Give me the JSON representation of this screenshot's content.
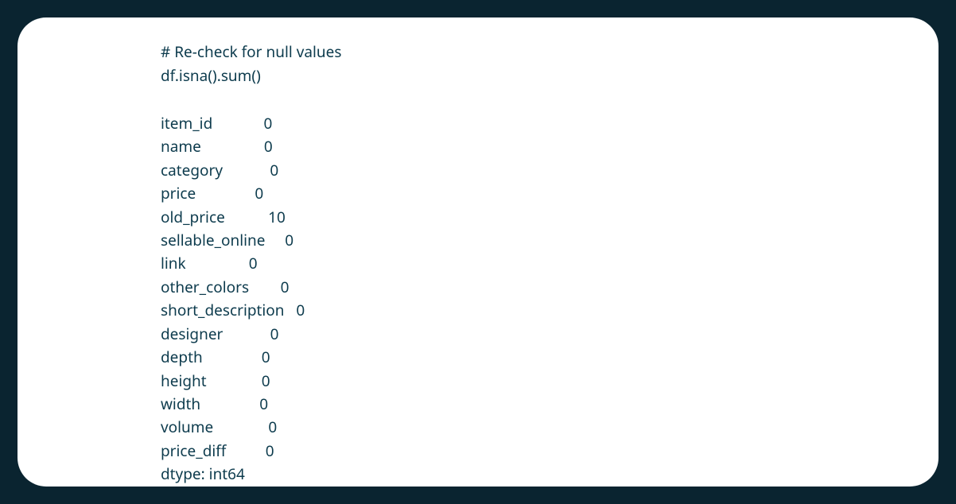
{
  "code": {
    "comment": "# Re-check for null values",
    "statement": "df.isna().sum()"
  },
  "output": {
    "rows": [
      {
        "label": "item_id",
        "value": "0"
      },
      {
        "label": "name",
        "value": "0"
      },
      {
        "label": "category",
        "value": "0"
      },
      {
        "label": "price",
        "value": "0"
      },
      {
        "label": "old_price",
        "value": "10"
      },
      {
        "label": "sellable_online",
        "value": "0"
      },
      {
        "label": "link",
        "value": "0"
      },
      {
        "label": "other_colors",
        "value": "0"
      },
      {
        "label": "short_description",
        "value": "0"
      },
      {
        "label": "designer",
        "value": "0"
      },
      {
        "label": "depth",
        "value": "0"
      },
      {
        "label": "height",
        "value": "0"
      },
      {
        "label": "width",
        "value": "0"
      },
      {
        "label": "volume",
        "value": "0"
      },
      {
        "label": "price_diff",
        "value": "0"
      }
    ],
    "dtype": "dtype: int64"
  }
}
